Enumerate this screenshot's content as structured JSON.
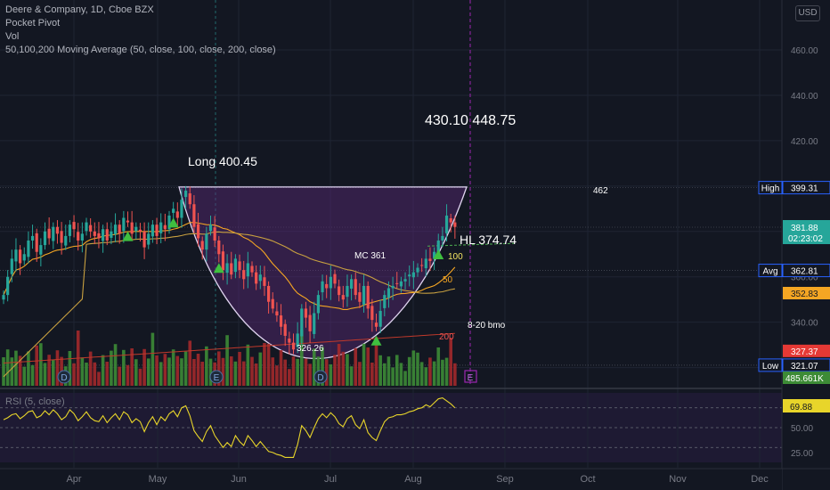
{
  "legend": {
    "symbol_line": "Deere & Company, 1D, Cboe BZX",
    "indicator1": "Pocket Pivot",
    "indicator2": "Vol",
    "indicator3": "50,100,200 Moving Average (50, close, 100, close, 200, close)"
  },
  "currency": "USD",
  "rsi_label": "RSI (5, close)",
  "colors": {
    "background": "#131722",
    "up": "#26a69a",
    "down": "#ef5350",
    "vol_up": "#3d8b36",
    "vol_down": "#a3292b",
    "ma50": "#f5a623",
    "ma100": "#c8a040",
    "ma200": "#c0392b",
    "cup_fill": "#5b2a78",
    "rsi_line": "#e8d52a",
    "pivot": "#3fbf3f"
  },
  "chart_data": {
    "type": "candlestick",
    "price_axis": {
      "min": 312,
      "max": 482,
      "ticks": [
        460,
        440,
        420,
        400,
        380,
        360,
        340,
        320
      ]
    },
    "x_axis": {
      "labels": [
        "Apr",
        "May",
        "Jun",
        "Jul",
        "Aug",
        "Sep",
        "Oct",
        "Nov",
        "Dec"
      ]
    },
    "rsi_axis": {
      "ticks": [
        75,
        50,
        25
      ],
      "levels": [
        70,
        50,
        30
      ],
      "current": "69.88"
    },
    "price_labels": [
      {
        "kind": "high",
        "label": "High",
        "value": "399.31",
        "price": 399.31
      },
      {
        "kind": "last",
        "value": "381.88",
        "countdown": "02:23:02",
        "price": 381.88
      },
      {
        "kind": "avg",
        "label": "Avg",
        "value": "362.81",
        "price": 362.81
      },
      {
        "kind": "ma50",
        "value": "352.83",
        "price": 352.83
      },
      {
        "kind": "ma200",
        "value": "327.37",
        "price": 327.37
      },
      {
        "kind": "low",
        "label": "Low",
        "value": "321.07",
        "price": 321.07
      },
      {
        "kind": "volume",
        "value": "485.661K"
      }
    ],
    "annotations": {
      "long": "Long 400.45",
      "targets": "430.10  448.75",
      "t462": "462",
      "hl": "HL 374.74",
      "mc": "MC 361",
      "ma100_label": "100",
      "ma50_label": "50",
      "ma200_label": "200",
      "cup_low": "326.26",
      "bmo": "8-20 bmo"
    },
    "events": [
      "D",
      "E",
      "D",
      "E"
    ],
    "closes": [
      352,
      360,
      368,
      372,
      366,
      370,
      376,
      378,
      371,
      374,
      380,
      377,
      382,
      379,
      375,
      378,
      383,
      381,
      376,
      379,
      384,
      380,
      378,
      377,
      381,
      376,
      380,
      383,
      379,
      386,
      384,
      379,
      382,
      380,
      373,
      379,
      383,
      378,
      384,
      381,
      387,
      390,
      386,
      394,
      398,
      392,
      382,
      377,
      372,
      379,
      383,
      376,
      370,
      363,
      366,
      361,
      368,
      363,
      359,
      366,
      362,
      357,
      361,
      356,
      349,
      346,
      343,
      338,
      334,
      331,
      328,
      335,
      346,
      342,
      336,
      344,
      352,
      358,
      355,
      360,
      357,
      352,
      350,
      356,
      359,
      352,
      349,
      356,
      346,
      341,
      338,
      345,
      352,
      355,
      356,
      357,
      358,
      359,
      361,
      362,
      364,
      365,
      368,
      367,
      371,
      376,
      378,
      387,
      384,
      382
    ],
    "rsi_values": [
      58,
      60,
      63,
      64,
      59,
      62,
      66,
      67,
      60,
      62,
      67,
      63,
      68,
      64,
      58,
      61,
      68,
      64,
      57,
      61,
      66,
      60,
      57,
      56,
      62,
      55,
      60,
      64,
      58,
      66,
      63,
      55,
      59,
      56,
      46,
      55,
      61,
      53,
      61,
      57,
      64,
      67,
      61,
      70,
      72,
      62,
      47,
      41,
      36,
      46,
      52,
      42,
      36,
      30,
      35,
      31,
      42,
      36,
      32,
      42,
      37,
      31,
      36,
      31,
      26,
      25,
      23,
      22,
      20,
      20,
      20,
      33,
      52,
      47,
      40,
      50,
      59,
      64,
      60,
      65,
      61,
      54,
      51,
      59,
      62,
      53,
      49,
      58,
      45,
      40,
      37,
      47,
      56,
      60,
      61,
      63,
      63,
      64,
      66,
      67,
      69,
      70,
      73,
      71,
      75,
      79,
      80,
      77,
      74,
      70
    ]
  }
}
